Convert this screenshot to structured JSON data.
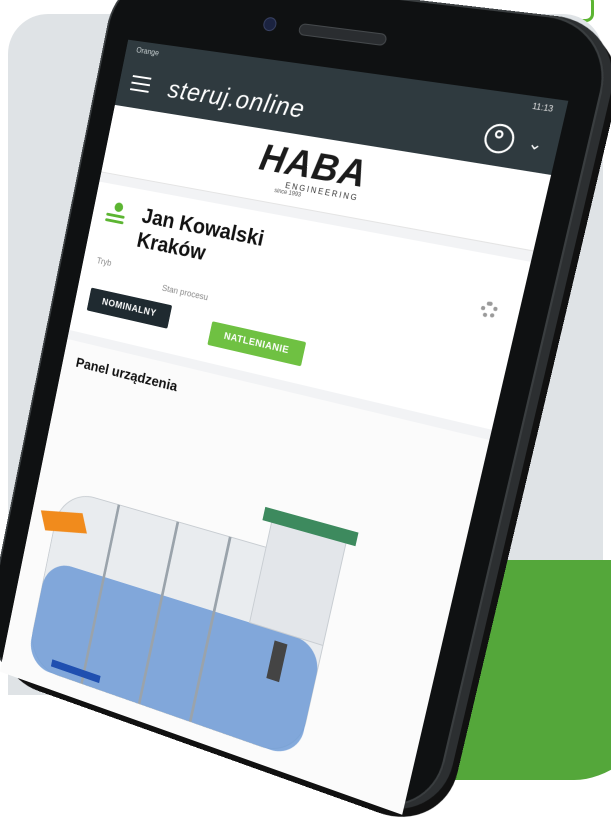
{
  "statusbar": {
    "carrier": "Orange",
    "time": "11:13"
  },
  "app": {
    "title": "steruj.online"
  },
  "logo": {
    "brand": "HABA",
    "sub": "ENGINEERING",
    "since": "since 1993"
  },
  "owner": {
    "name": "Jan Kowalski",
    "city": "Kraków"
  },
  "mode": {
    "label": "Tryb",
    "value": "NOMINALNY"
  },
  "process": {
    "label": "Stan procesu",
    "value": "NATLENIANIE"
  },
  "panel": {
    "title": "Panel urządzenia"
  },
  "colors": {
    "topbar": "#2f3a3f",
    "accent_green": "#6fc142",
    "dark_badge": "#1f2a30"
  },
  "icons": [
    "menu-icon",
    "user-icon",
    "chevron-down-icon",
    "gear-icon",
    "owner-wave-icon"
  ]
}
